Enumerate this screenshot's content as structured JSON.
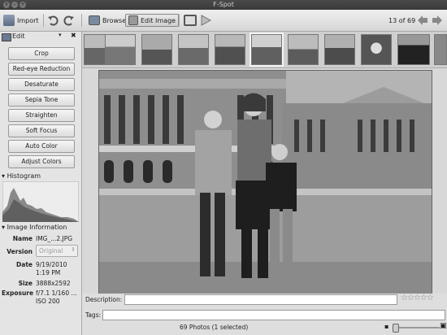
{
  "window": {
    "title": "F-Spot"
  },
  "toolbar": {
    "import": "Import",
    "browse": "Browse",
    "edit_image": "Edit Image",
    "counter": "13 of 69"
  },
  "sidebar": {
    "edit_header": "Edit",
    "edit_buttons": [
      "Crop",
      "Red-eye Reduction",
      "Desaturate",
      "Sepia Tone",
      "Straighten",
      "Soft Focus",
      "Auto Color",
      "Adjust Colors"
    ],
    "histogram_header": "Histogram",
    "info_header": "Image Information",
    "info": {
      "name_label": "Name",
      "name_value": "IMG_...2.JPG",
      "version_label": "Version",
      "version_value": "Original",
      "date_label": "Date",
      "date_value": "9/19/2010",
      "time_value": "1:19 PM",
      "size_label": "Size",
      "size_value": "3888x2592",
      "exposure_label": "Exposure",
      "exposure_value": "f/7.1 1/160 ...",
      "iso_value": "ISO 200"
    }
  },
  "bottom": {
    "description_label": "Description:",
    "tags_label": "Tags:",
    "status": "69 Photos (1 selected)"
  }
}
